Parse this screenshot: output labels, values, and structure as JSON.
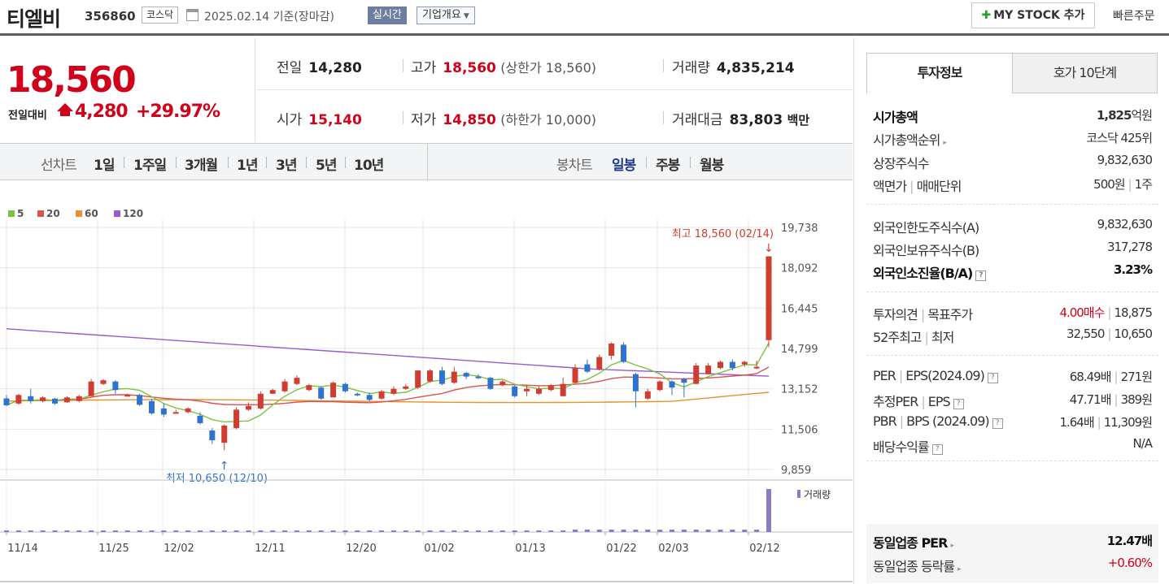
{
  "header": {
    "stock_name": "티엘비",
    "stock_code": "356860",
    "market": "코스닥",
    "date": "2025.02.14",
    "date_suffix": "기준(장마감)",
    "realtime_label": "실시간",
    "company_info_label": "기업개요",
    "mystock_label": "MY STOCK 추가",
    "quick_order_label": "빠른주문"
  },
  "price": {
    "current": "18,560",
    "compare_label": "전일대비",
    "change": "4,280",
    "change_pct": "+29.97%",
    "up_color": "#d0021b"
  },
  "stats": {
    "prev_close_label": "전일",
    "prev_close": "14,280",
    "high_label": "고가",
    "high": "18,560",
    "upper_limit": "(상한가 18,560)",
    "volume_label": "거래량",
    "volume": "4,835,214",
    "open_label": "시가",
    "open": "15,140",
    "low_label": "저가",
    "low": "14,850",
    "lower_limit": "(하한가 10,000)",
    "amount_label": "거래대금",
    "amount": "83,803",
    "amount_unit": "백만"
  },
  "chart_tabs": {
    "line_label": "선차트",
    "line_periods": [
      "1일",
      "1주일",
      "3개월",
      "1년",
      "3년",
      "5년",
      "10년"
    ],
    "candle_label": "봉차트",
    "candle_periods": [
      "일봉",
      "주봉",
      "월봉"
    ],
    "active_candle": "일봉"
  },
  "chart_data": {
    "type": "candlestick",
    "legend": [
      {
        "name": "5",
        "color": "#7cc242"
      },
      {
        "name": "20",
        "color": "#d9534f"
      },
      {
        "name": "60",
        "color": "#e8912d"
      },
      {
        "name": "120",
        "color": "#9b59d0"
      }
    ],
    "y_ticks": [
      "19,738",
      "18,092",
      "16,445",
      "14,799",
      "13,152",
      "11,506",
      "9,859"
    ],
    "ylim": [
      9859,
      19738
    ],
    "x_ticks": [
      "11/14",
      "11/25",
      "12/02",
      "12/11",
      "12/20",
      "01/02",
      "01/13",
      "01/22",
      "02/03",
      "02/12"
    ],
    "max_annotation": "최고 18,560 (02/14)",
    "min_annotation": "최저 10,650 (12/10)",
    "volume_label": "거래량",
    "candles": [
      {
        "o": 12760,
        "c": 12480,
        "h": 12900,
        "l": 12450
      },
      {
        "o": 12550,
        "c": 12900,
        "h": 12950,
        "l": 12500
      },
      {
        "o": 12850,
        "c": 12650,
        "h": 13150,
        "l": 12550
      },
      {
        "o": 12650,
        "c": 12800,
        "h": 12850,
        "l": 12600
      },
      {
        "o": 12750,
        "c": 12550,
        "h": 12780,
        "l": 12500
      },
      {
        "o": 12600,
        "c": 12800,
        "h": 12850,
        "l": 12580
      },
      {
        "o": 12650,
        "c": 12850,
        "h": 12900,
        "l": 12600
      },
      {
        "o": 12850,
        "c": 13450,
        "h": 13550,
        "l": 12850
      },
      {
        "o": 13350,
        "c": 13500,
        "h": 13550,
        "l": 13300
      },
      {
        "o": 13450,
        "c": 13100,
        "h": 13500,
        "l": 12950
      },
      {
        "o": 12900,
        "c": 12900,
        "h": 12950,
        "l": 12850
      },
      {
        "o": 12900,
        "c": 12500,
        "h": 12950,
        "l": 12450
      },
      {
        "o": 12650,
        "c": 12150,
        "h": 12750,
        "l": 12100
      },
      {
        "o": 12350,
        "c": 12100,
        "h": 12550,
        "l": 12000
      },
      {
        "o": 12150,
        "c": 12200,
        "h": 12300,
        "l": 12150
      },
      {
        "o": 12200,
        "c": 12350,
        "h": 12400,
        "l": 12150
      },
      {
        "o": 12050,
        "c": 11750,
        "h": 12200,
        "l": 11700
      },
      {
        "o": 11450,
        "c": 11050,
        "h": 11550,
        "l": 10900
      },
      {
        "o": 10950,
        "c": 11650,
        "h": 11700,
        "l": 10650
      },
      {
        "o": 11550,
        "c": 12300,
        "h": 12400,
        "l": 11500
      },
      {
        "o": 12300,
        "c": 12450,
        "h": 12600,
        "l": 12250
      },
      {
        "o": 12350,
        "c": 12950,
        "h": 13050,
        "l": 12300
      },
      {
        "o": 12950,
        "c": 13100,
        "h": 13150,
        "l": 12950
      },
      {
        "o": 13050,
        "c": 13450,
        "h": 13550,
        "l": 13000
      },
      {
        "o": 13350,
        "c": 13600,
        "h": 13700,
        "l": 13300
      },
      {
        "o": 13100,
        "c": 13300,
        "h": 13350,
        "l": 13050
      },
      {
        "o": 13200,
        "c": 12750,
        "h": 13250,
        "l": 12700
      },
      {
        "o": 12800,
        "c": 13400,
        "h": 13450,
        "l": 12800
      },
      {
        "o": 13350,
        "c": 13050,
        "h": 13400,
        "l": 13000
      },
      {
        "o": 12950,
        "c": 12900,
        "h": 13000,
        "l": 12850
      },
      {
        "o": 12900,
        "c": 12700,
        "h": 13000,
        "l": 12650
      },
      {
        "o": 12750,
        "c": 13050,
        "h": 13100,
        "l": 12700
      },
      {
        "o": 12950,
        "c": 13150,
        "h": 13250,
        "l": 12900
      },
      {
        "o": 13150,
        "c": 13250,
        "h": 13350,
        "l": 13100
      },
      {
        "o": 13200,
        "c": 13900,
        "h": 13900,
        "l": 13150
      },
      {
        "o": 13450,
        "c": 13900,
        "h": 13950,
        "l": 13400
      },
      {
        "o": 13900,
        "c": 13350,
        "h": 14050,
        "l": 13300
      },
      {
        "o": 13400,
        "c": 13850,
        "h": 14050,
        "l": 13350
      },
      {
        "o": 13800,
        "c": 13650,
        "h": 13850,
        "l": 13550
      },
      {
        "o": 13650,
        "c": 13600,
        "h": 13750,
        "l": 13550
      },
      {
        "o": 13600,
        "c": 13150,
        "h": 13650,
        "l": 13100
      },
      {
        "o": 13300,
        "c": 13450,
        "h": 13500,
        "l": 13250
      },
      {
        "o": 13250,
        "c": 12850,
        "h": 13300,
        "l": 12800
      },
      {
        "o": 13050,
        "c": 13150,
        "h": 13300,
        "l": 12850
      },
      {
        "o": 12950,
        "c": 13150,
        "h": 13250,
        "l": 12900
      },
      {
        "o": 13100,
        "c": 13300,
        "h": 13350,
        "l": 13050
      },
      {
        "o": 12850,
        "c": 13350,
        "h": 13600,
        "l": 12850
      },
      {
        "o": 13400,
        "c": 14000,
        "h": 14150,
        "l": 13400
      },
      {
        "o": 14150,
        "c": 13850,
        "h": 14350,
        "l": 13800
      },
      {
        "o": 13950,
        "c": 14450,
        "h": 14550,
        "l": 13900
      },
      {
        "o": 14500,
        "c": 15000,
        "h": 15050,
        "l": 14350
      },
      {
        "o": 14950,
        "c": 14250,
        "h": 15050,
        "l": 14200
      },
      {
        "o": 13750,
        "c": 13050,
        "h": 13800,
        "l": 12400
      },
      {
        "o": 12750,
        "c": 13050,
        "h": 13150,
        "l": 12700
      },
      {
        "o": 13100,
        "c": 13450,
        "h": 13500,
        "l": 13050
      },
      {
        "o": 13450,
        "c": 13200,
        "h": 13500,
        "l": 12900
      },
      {
        "o": 13550,
        "c": 13400,
        "h": 13600,
        "l": 12800
      },
      {
        "o": 13350,
        "c": 14100,
        "h": 14200,
        "l": 13350
      },
      {
        "o": 13750,
        "c": 14100,
        "h": 14200,
        "l": 13750
      },
      {
        "o": 14000,
        "c": 14250,
        "h": 14300,
        "l": 13950
      },
      {
        "o": 14250,
        "c": 14000,
        "h": 14350,
        "l": 13900
      },
      {
        "o": 14150,
        "c": 14250,
        "h": 14300,
        "l": 14050
      },
      {
        "o": 14050,
        "c": 14050,
        "h": 14300,
        "l": 13950
      },
      {
        "o": 15140,
        "c": 18560,
        "h": 18560,
        "l": 14850
      }
    ]
  },
  "invest_tabs": {
    "active": "투자정보",
    "other": "호가 10단계"
  },
  "invest": {
    "market_cap_label": "시가총액",
    "market_cap": "1,825",
    "market_cap_unit": "억원",
    "market_cap_rank_label": "시가총액순위",
    "market_cap_rank": "코스닥 425위",
    "shares_label": "상장주식수",
    "shares": "9,832,630",
    "par_label": "액면가",
    "lot_label": "매매단위",
    "par": "500원",
    "lot": "1주",
    "foreign_limit_label": "외국인한도주식수(A)",
    "foreign_limit": "9,832,630",
    "foreign_hold_label": "외국인보유주식수(B)",
    "foreign_hold": "317,278",
    "foreign_ratio_label": "외국인소진율(B/A)",
    "foreign_ratio": "3.23%",
    "opinion_label": "투자의견",
    "target_label": "목표주가",
    "opinion": "4.00매수",
    "target": "18,875",
    "w52_label": "52주최고",
    "w52_low_label": "최저",
    "w52_high": "32,550",
    "w52_low": "10,650",
    "per_label": "PER",
    "eps_label": "EPS(2024.09)",
    "per": "68.49배",
    "eps": "271원",
    "fper_label": "추정PER",
    "feps_label": "EPS",
    "fper": "47.71배",
    "feps": "389원",
    "pbr_label": "PBR",
    "bps_label": "BPS (2024.09)",
    "pbr": "1.64배",
    "bps": "11,309원",
    "div_label": "배당수익률",
    "div": "N/A",
    "ind_per_label": "동일업종 PER",
    "ind_per": "12.47배",
    "ind_chg_label": "동일업종 등락률",
    "ind_chg": "+0.60%"
  }
}
